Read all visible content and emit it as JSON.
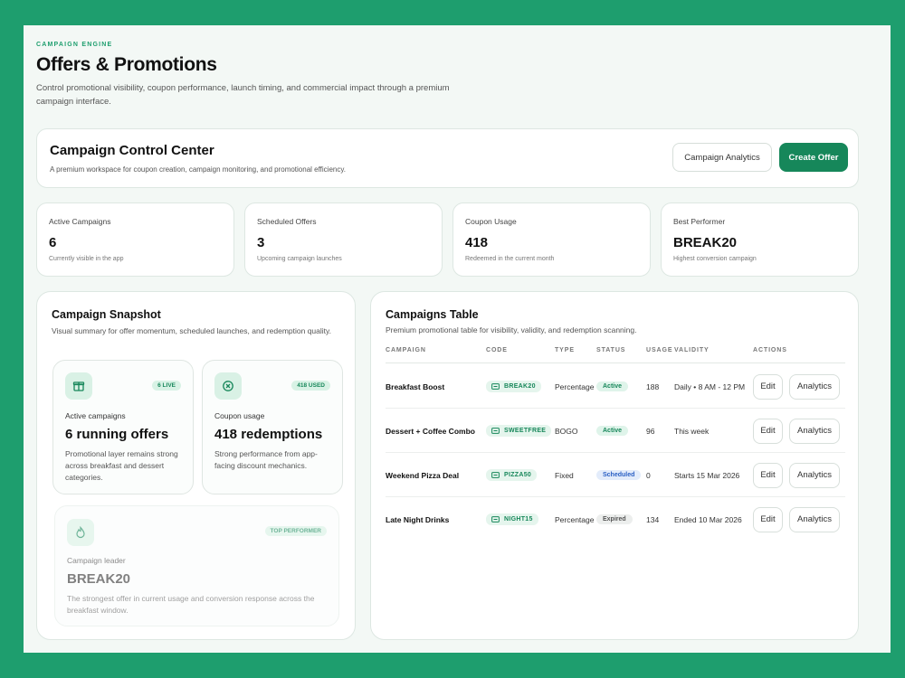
{
  "header": {
    "eyebrow": "CAMPAIGN ENGINE",
    "title": "Offers & Promotions",
    "description": "Control promotional visibility, coupon performance, launch timing, and commercial impact through a premium campaign interface."
  },
  "control_center": {
    "title": "Campaign Control Center",
    "subtitle": "A premium workspace for coupon creation, campaign monitoring, and promotional efficiency.",
    "analytics_button": "Campaign Analytics",
    "create_button": "Create Offer"
  },
  "stats": [
    {
      "label": "Active Campaigns",
      "value": "6",
      "caption": "Currently visible in the app"
    },
    {
      "label": "Scheduled Offers",
      "value": "3",
      "caption": "Upcoming campaign launches"
    },
    {
      "label": "Coupon Usage",
      "value": "418",
      "caption": "Redeemed in the current month"
    },
    {
      "label": "Best Performer",
      "value": "BREAK20",
      "caption": "Highest conversion campaign"
    }
  ],
  "snapshot": {
    "title": "Campaign Snapshot",
    "subtitle": "Visual summary for offer momentum, scheduled launches, and redemption quality.",
    "active": {
      "badge": "6 LIVE",
      "label": "Active campaigns",
      "value": "6 running offers",
      "desc": "Promotional layer remains strong across breakfast and dessert categories."
    },
    "usage": {
      "badge": "418 USED",
      "label": "Coupon usage",
      "value": "418 redemptions",
      "desc": "Strong performance from app-facing discount mechanics."
    },
    "leader": {
      "badge": "TOP PERFORMER",
      "label": "Campaign leader",
      "value": "BREAK20",
      "desc": "The strongest offer in current usage and conversion response across the breakfast window."
    }
  },
  "table": {
    "title": "Campaigns Table",
    "subtitle": "Premium promotional table for visibility, validity, and redemption scanning.",
    "headers": {
      "campaign": "CAMPAIGN",
      "code": "CODE",
      "type": "TYPE",
      "status": "STATUS",
      "usage": "USAGE",
      "validity": "VALIDITY",
      "actions": "ACTIONS"
    },
    "edit_label": "Edit",
    "analytics_label": "Analytics",
    "rows": [
      {
        "campaign": "Breakfast Boost",
        "code": "BREAK20",
        "type": "Percentage",
        "status": "Active",
        "usage": "188",
        "validity": "Daily • 8 AM - 12 PM"
      },
      {
        "campaign": "Dessert + Coffee Combo",
        "code": "SWEETFREE",
        "type": "BOGO",
        "status": "Active",
        "usage": "96",
        "validity": "This week"
      },
      {
        "campaign": "Weekend Pizza Deal",
        "code": "PIZZA50",
        "type": "Fixed",
        "status": "Scheduled",
        "usage": "0",
        "validity": "Starts 15 Mar 2026"
      },
      {
        "campaign": "Late Night Drinks",
        "code": "NIGHT15",
        "type": "Percentage",
        "status": "Expired",
        "usage": "134",
        "validity": "Ended 10 Mar 2026"
      }
    ]
  },
  "colors": {
    "brand": "#1e9e6e",
    "primary_button": "#16875a",
    "background": "#f3f8f5"
  }
}
